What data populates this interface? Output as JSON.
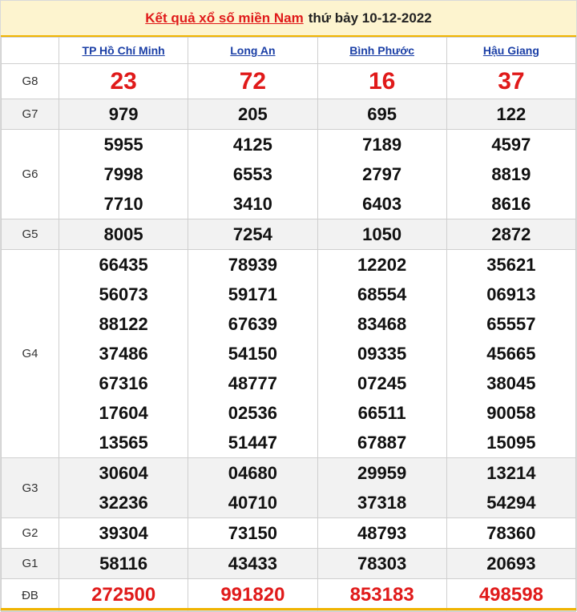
{
  "header": {
    "title_link": "Kết quả xổ số miền Nam",
    "title_rest": "thứ bảy 10-12-2022"
  },
  "provinces": [
    "TP Hồ Chí Minh",
    "Long An",
    "Bình Phước",
    "Hậu Giang"
  ],
  "labels": {
    "g8": "G8",
    "g7": "G7",
    "g6": "G6",
    "g5": "G5",
    "g4": "G4",
    "g3": "G3",
    "g2": "G2",
    "g1": "G1",
    "db": "ĐB"
  },
  "prizes": {
    "g8": [
      "23",
      "72",
      "16",
      "37"
    ],
    "g7": [
      "979",
      "205",
      "695",
      "122"
    ],
    "g6": [
      [
        "5955",
        "7998",
        "7710"
      ],
      [
        "4125",
        "6553",
        "3410"
      ],
      [
        "7189",
        "2797",
        "6403"
      ],
      [
        "4597",
        "8819",
        "8616"
      ]
    ],
    "g5": [
      "8005",
      "7254",
      "1050",
      "2872"
    ],
    "g4": [
      [
        "66435",
        "56073",
        "88122",
        "37486",
        "67316",
        "17604",
        "13565"
      ],
      [
        "78939",
        "59171",
        "67639",
        "54150",
        "48777",
        "02536",
        "51447"
      ],
      [
        "12202",
        "68554",
        "83468",
        "09335",
        "07245",
        "66511",
        "67887"
      ],
      [
        "35621",
        "06913",
        "65557",
        "45665",
        "38045",
        "90058",
        "15095"
      ]
    ],
    "g3": [
      [
        "30604",
        "32236"
      ],
      [
        "04680",
        "40710"
      ],
      [
        "29959",
        "37318"
      ],
      [
        "13214",
        "54294"
      ]
    ],
    "g2": [
      "39304",
      "73150",
      "48793",
      "78360"
    ],
    "g1": [
      "58116",
      "43433",
      "78303",
      "20693"
    ],
    "db": [
      "272500",
      "991820",
      "853183",
      "498598"
    ]
  }
}
